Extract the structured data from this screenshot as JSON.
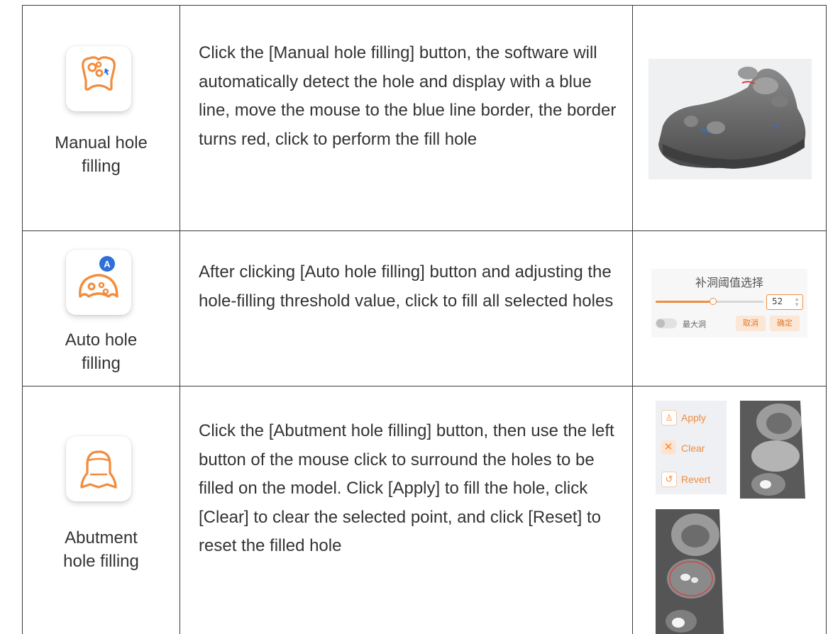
{
  "rows": [
    {
      "label": "Manual hole filling",
      "label_lines": [
        "Manual hole",
        "filling"
      ],
      "icon": "manual-hole-filling-icon",
      "description": "Click the [Manual hole filling] button, the software will automatically detect the hole and display with a blue line, move the mouse to the blue line border, the border turns red, click to perform the fill hole"
    },
    {
      "label": "Auto hole filling",
      "label_lines": [
        "Auto hole",
        "filling"
      ],
      "icon": "auto-hole-filling-icon",
      "icon_badge": "A",
      "description": "After clicking [Auto hole filling] button and adjusting the hole-filling threshold value, click to fill all selected holes",
      "panel": {
        "title": "补洞阈值选择",
        "value": "52",
        "toggle_label": "最大洞",
        "cancel": "取消",
        "confirm": "确定"
      }
    },
    {
      "label": "Abutment hole filling",
      "label_lines": [
        "Abutment",
        "hole filling"
      ],
      "icon": "abutment-hole-filling-icon",
      "description": "Click the [Abutment hole filling] button, then use the left button of the mouse click to surround the holes to be filled on the model. Click [Apply] to fill the hole, click [Clear] to clear the selected point, and click [Reset] to reset the filled hole",
      "menu": [
        {
          "icon": "tooth-icon",
          "label": "Apply"
        },
        {
          "icon": "close-icon",
          "label": "Clear"
        },
        {
          "icon": "revert-icon",
          "label": "Revert"
        }
      ]
    }
  ],
  "colors": {
    "accent": "#f28c3c",
    "border": "#3a3a3a",
    "text": "#333333",
    "model_gray": "#6b6b6b",
    "highlight_blue": "#2f6fd6",
    "highlight_red": "#d93c3c"
  }
}
